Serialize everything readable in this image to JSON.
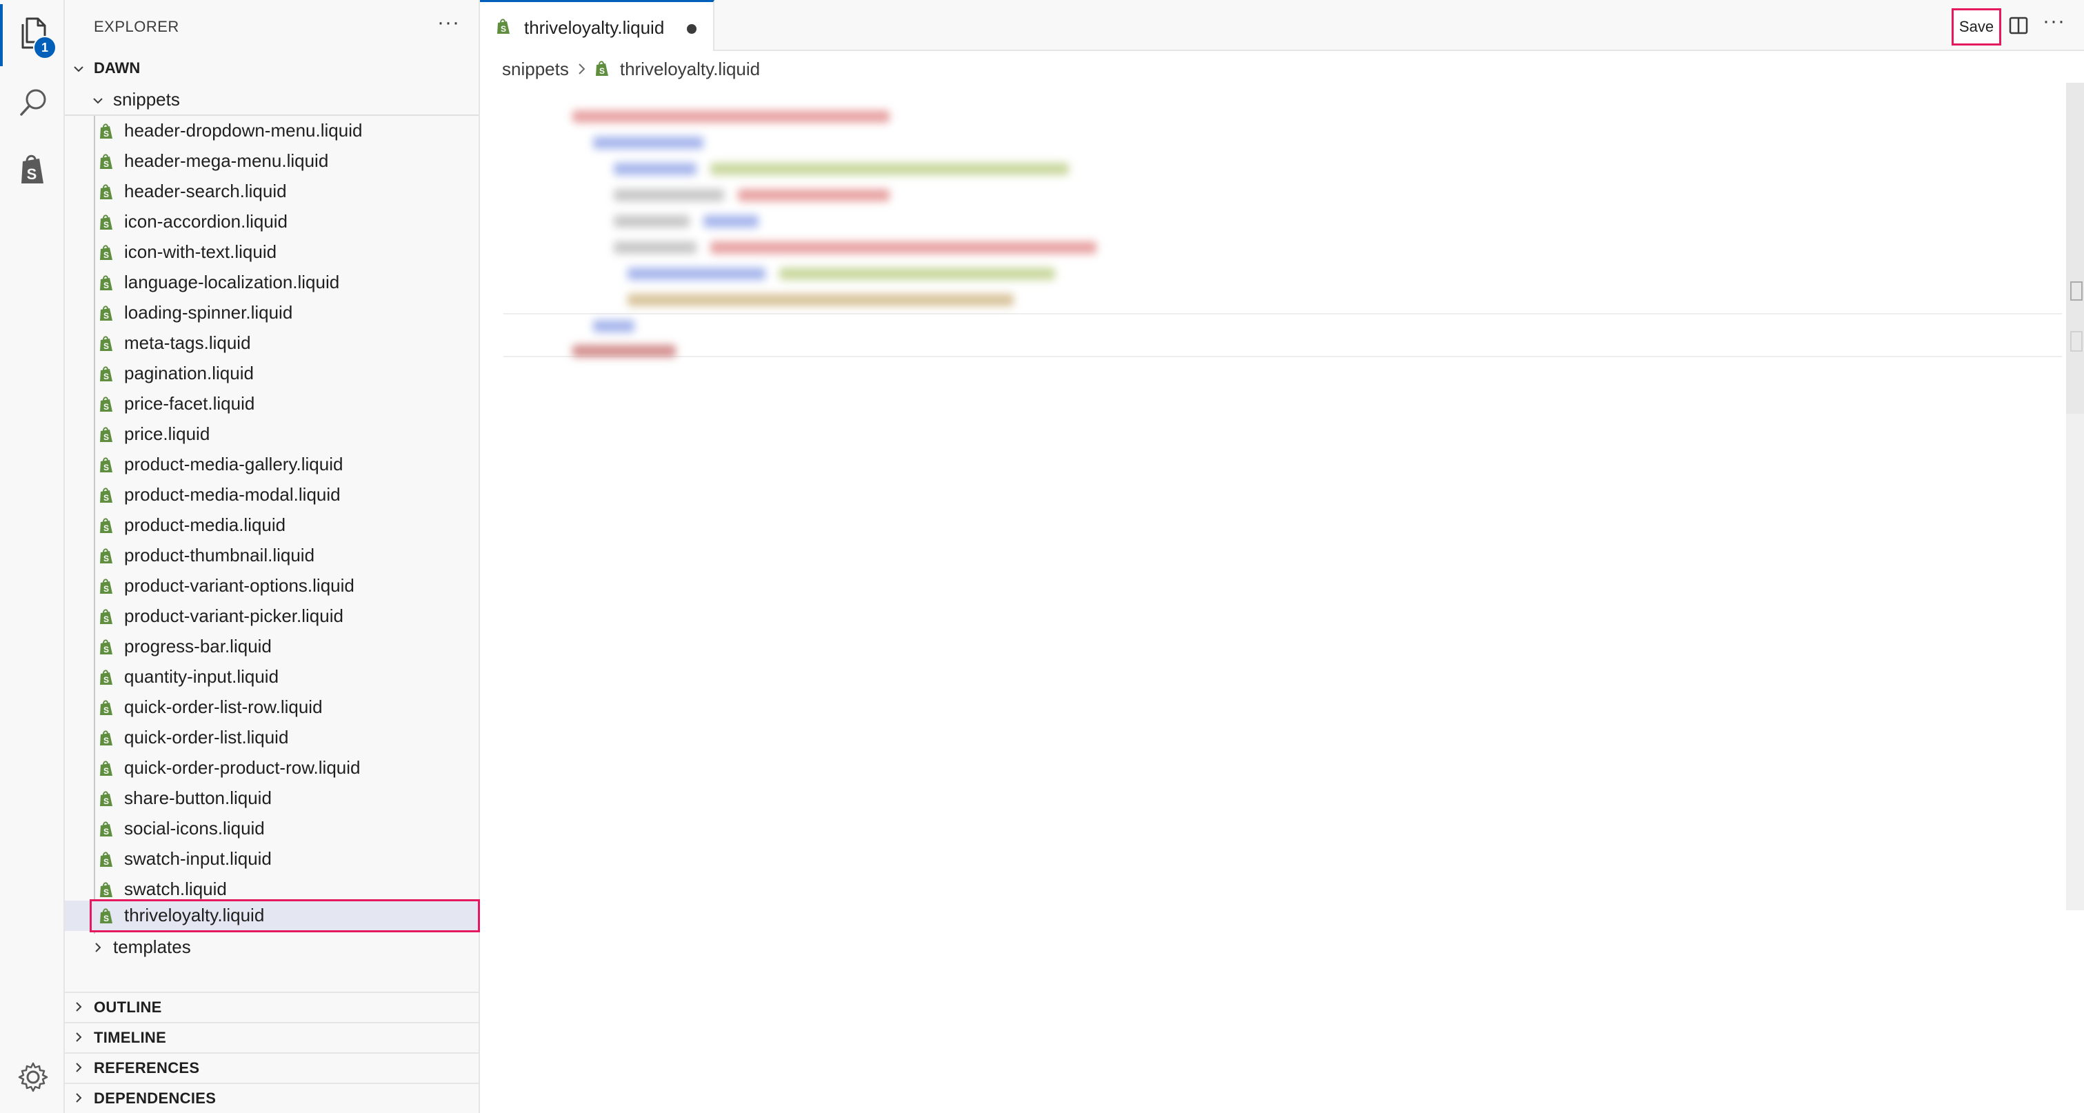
{
  "sidebar": {
    "title": "EXPLORER",
    "more": "···",
    "root": "DAWN",
    "folder": "snippets",
    "files": [
      "header-dropdown-menu.liquid",
      "header-mega-menu.liquid",
      "header-search.liquid",
      "icon-accordion.liquid",
      "icon-with-text.liquid",
      "language-localization.liquid",
      "loading-spinner.liquid",
      "meta-tags.liquid",
      "pagination.liquid",
      "price-facet.liquid",
      "price.liquid",
      "product-media-gallery.liquid",
      "product-media-modal.liquid",
      "product-media.liquid",
      "product-thumbnail.liquid",
      "product-variant-options.liquid",
      "product-variant-picker.liquid",
      "progress-bar.liquid",
      "quantity-input.liquid",
      "quick-order-list-row.liquid",
      "quick-order-list.liquid",
      "quick-order-product-row.liquid",
      "share-button.liquid",
      "social-icons.liquid",
      "swatch-input.liquid",
      "swatch.liquid",
      "thriveloyalty.liquid"
    ],
    "templates": "templates",
    "sections": [
      "OUTLINE",
      "TIMELINE",
      "REFERENCES",
      "DEPENDENCIES"
    ]
  },
  "activity": {
    "badge": "1"
  },
  "editor": {
    "tab_label": "thriveloyalty.liquid",
    "save_label": "Save",
    "more": "···",
    "breadcrumb": {
      "folder": "snippets",
      "file": "thriveloyalty.liquid"
    }
  },
  "colors": {
    "accent": "#005fb8",
    "highlight": "#e5195e",
    "shopify_green": "#5e8e3e",
    "selected_row": "#e4e6f1"
  }
}
